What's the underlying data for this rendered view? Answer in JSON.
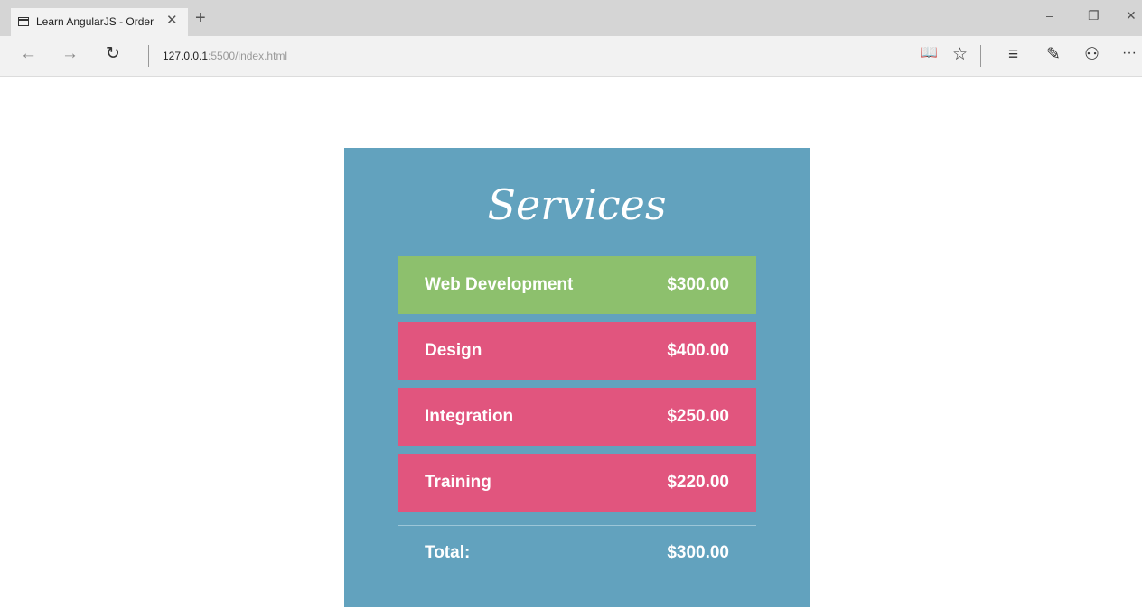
{
  "browser": {
    "tab": {
      "title": "Learn AngularJS - Order",
      "icon": "tab-page-icon",
      "close_glyph": "✕"
    },
    "new_tab_glyph": "+",
    "window_controls": {
      "minimize": "–",
      "restore": "❐",
      "close": "✕"
    },
    "nav": {
      "back": "←",
      "forward": "→",
      "refresh": "↻"
    },
    "address": {
      "host": "127.0.0.1",
      "rest": ":5500/index.html"
    },
    "toolbar": {
      "reading_view": "📖",
      "favorite": "☆",
      "hub": "≡",
      "web_note": "✎",
      "share": "⚇",
      "more": "···"
    }
  },
  "page": {
    "title": "Services",
    "services": [
      {
        "name": "Web Development",
        "price": "$300.00",
        "active": true
      },
      {
        "name": "Design",
        "price": "$400.00",
        "active": false
      },
      {
        "name": "Integration",
        "price": "$250.00",
        "active": false
      },
      {
        "name": "Training",
        "price": "$220.00",
        "active": false
      }
    ],
    "total_label": "Total:",
    "total_value": "$300.00",
    "colors": {
      "card_bg": "#62a2be",
      "active_row": "#8dc06d",
      "inactive_row": "#e1557e"
    }
  }
}
